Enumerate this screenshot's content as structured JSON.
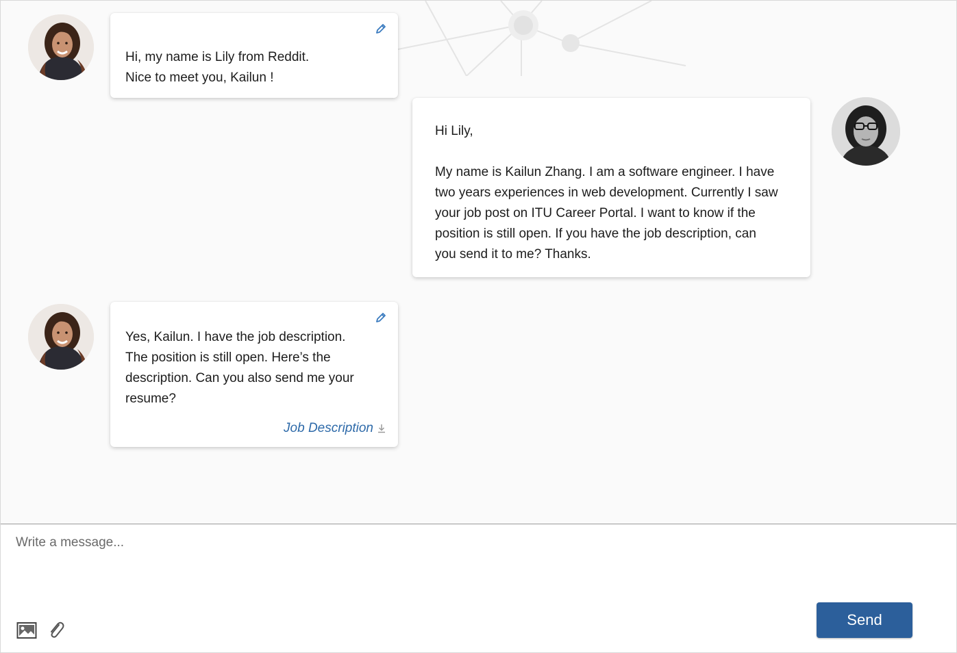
{
  "messages": [
    {
      "sender": "Lily",
      "side": "left",
      "lines": [
        "Hi, my name is Lily from Reddit.",
        "Nice to meet you, Kailun !"
      ],
      "editable": true
    },
    {
      "sender": "Kailun",
      "side": "right",
      "greeting": "Hi Lily,",
      "lines": [
        "My name is Kailun Zhang. I am a software engineer. I have",
        "two years experiences in web development. Currently I saw",
        "your job post on ITU Career Portal. I want to know if the",
        "position is still open. If you have the job description, can",
        "you send it to me? Thanks."
      ]
    },
    {
      "sender": "Lily",
      "side": "left",
      "lines": [
        "Yes,  Kailun. I have the job description.",
        "The position is still open. Here’s the",
        "description. Can you also send me your",
        "resume?"
      ],
      "attachment": "Job Description",
      "editable": true
    }
  ],
  "composer": {
    "placeholder": "Write a message...",
    "send_label": "Send",
    "icons": [
      "image-icon",
      "paperclip-icon"
    ]
  },
  "colors": {
    "accent": "#2c5f9b",
    "link": "#2e6aa9",
    "pencil": "#3a7bbf"
  }
}
